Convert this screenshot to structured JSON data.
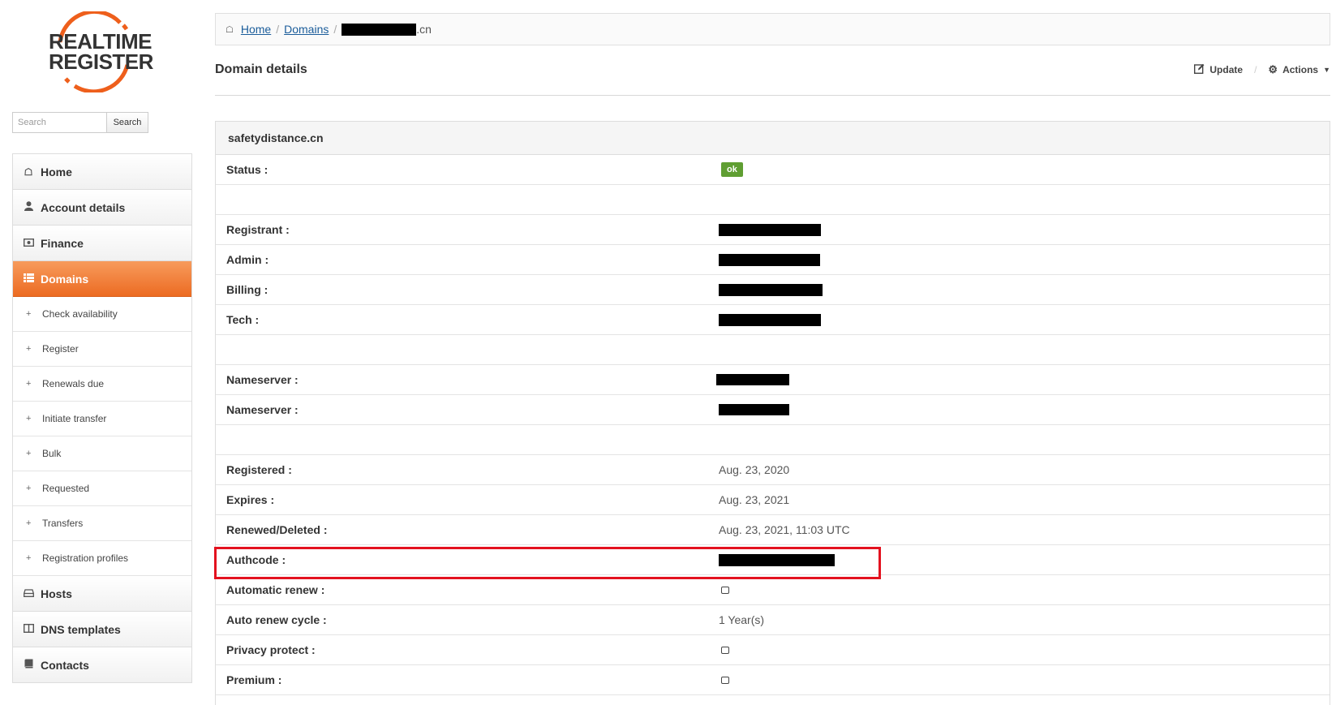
{
  "logo": {
    "line1": "REALTIME",
    "line2": "REGISTER",
    "ring_color": "#ee5f1c"
  },
  "search": {
    "placeholder": "Search",
    "button_label": "Search"
  },
  "sidebar": {
    "items": [
      {
        "label": "Home",
        "icon": "home-icon"
      },
      {
        "label": "Account details",
        "icon": "user-icon"
      },
      {
        "label": "Finance",
        "icon": "money-icon"
      },
      {
        "label": "Domains",
        "icon": "list-icon",
        "active": true
      }
    ],
    "domain_subitems": [
      {
        "label": "Check availability"
      },
      {
        "label": "Register"
      },
      {
        "label": "Renewals due"
      },
      {
        "label": "Initiate transfer"
      },
      {
        "label": "Bulk"
      },
      {
        "label": "Requested"
      },
      {
        "label": "Transfers"
      },
      {
        "label": "Registration profiles"
      }
    ],
    "items_after": [
      {
        "label": "Hosts",
        "icon": "hdd-icon"
      },
      {
        "label": "DNS templates",
        "icon": "columns-icon"
      },
      {
        "label": "Contacts",
        "icon": "book-icon"
      }
    ],
    "active_color": "#ee6f26"
  },
  "breadcrumb": {
    "home": "Home",
    "domains": "Domains",
    "current_suffix": ".cn"
  },
  "header": {
    "title": "Domain details",
    "update_label": "Update",
    "actions_label": "Actions"
  },
  "panel": {
    "title": "safetydistance.cn",
    "status_label": "Status :",
    "status_value": "ok",
    "registrant_label": "Registrant :",
    "admin_label": "Admin :",
    "billing_label": "Billing :",
    "tech_label": "Tech :",
    "ns1_label": "Nameserver :",
    "ns2_label": "Nameserver :",
    "registered_label": "Registered :",
    "registered_value": "Aug. 23, 2020",
    "expires_label": "Expires :",
    "expires_value": "Aug. 23, 2021",
    "renewed_label": "Renewed/Deleted :",
    "renewed_value": "Aug. 23, 2021, 11:03 UTC",
    "authcode_label": "Authcode :",
    "autorenew_label": "Automatic renew :",
    "autorenew_checked": false,
    "cycle_label": "Auto renew cycle :",
    "cycle_value": "1 Year(s)",
    "privacy_label": "Privacy protect :",
    "privacy_checked": false,
    "premium_label": "Premium :",
    "premium_checked": false
  },
  "colors": {
    "status_ok": "#5f9e32",
    "highlight": "#e3121f",
    "link": "#1a5c9a"
  }
}
